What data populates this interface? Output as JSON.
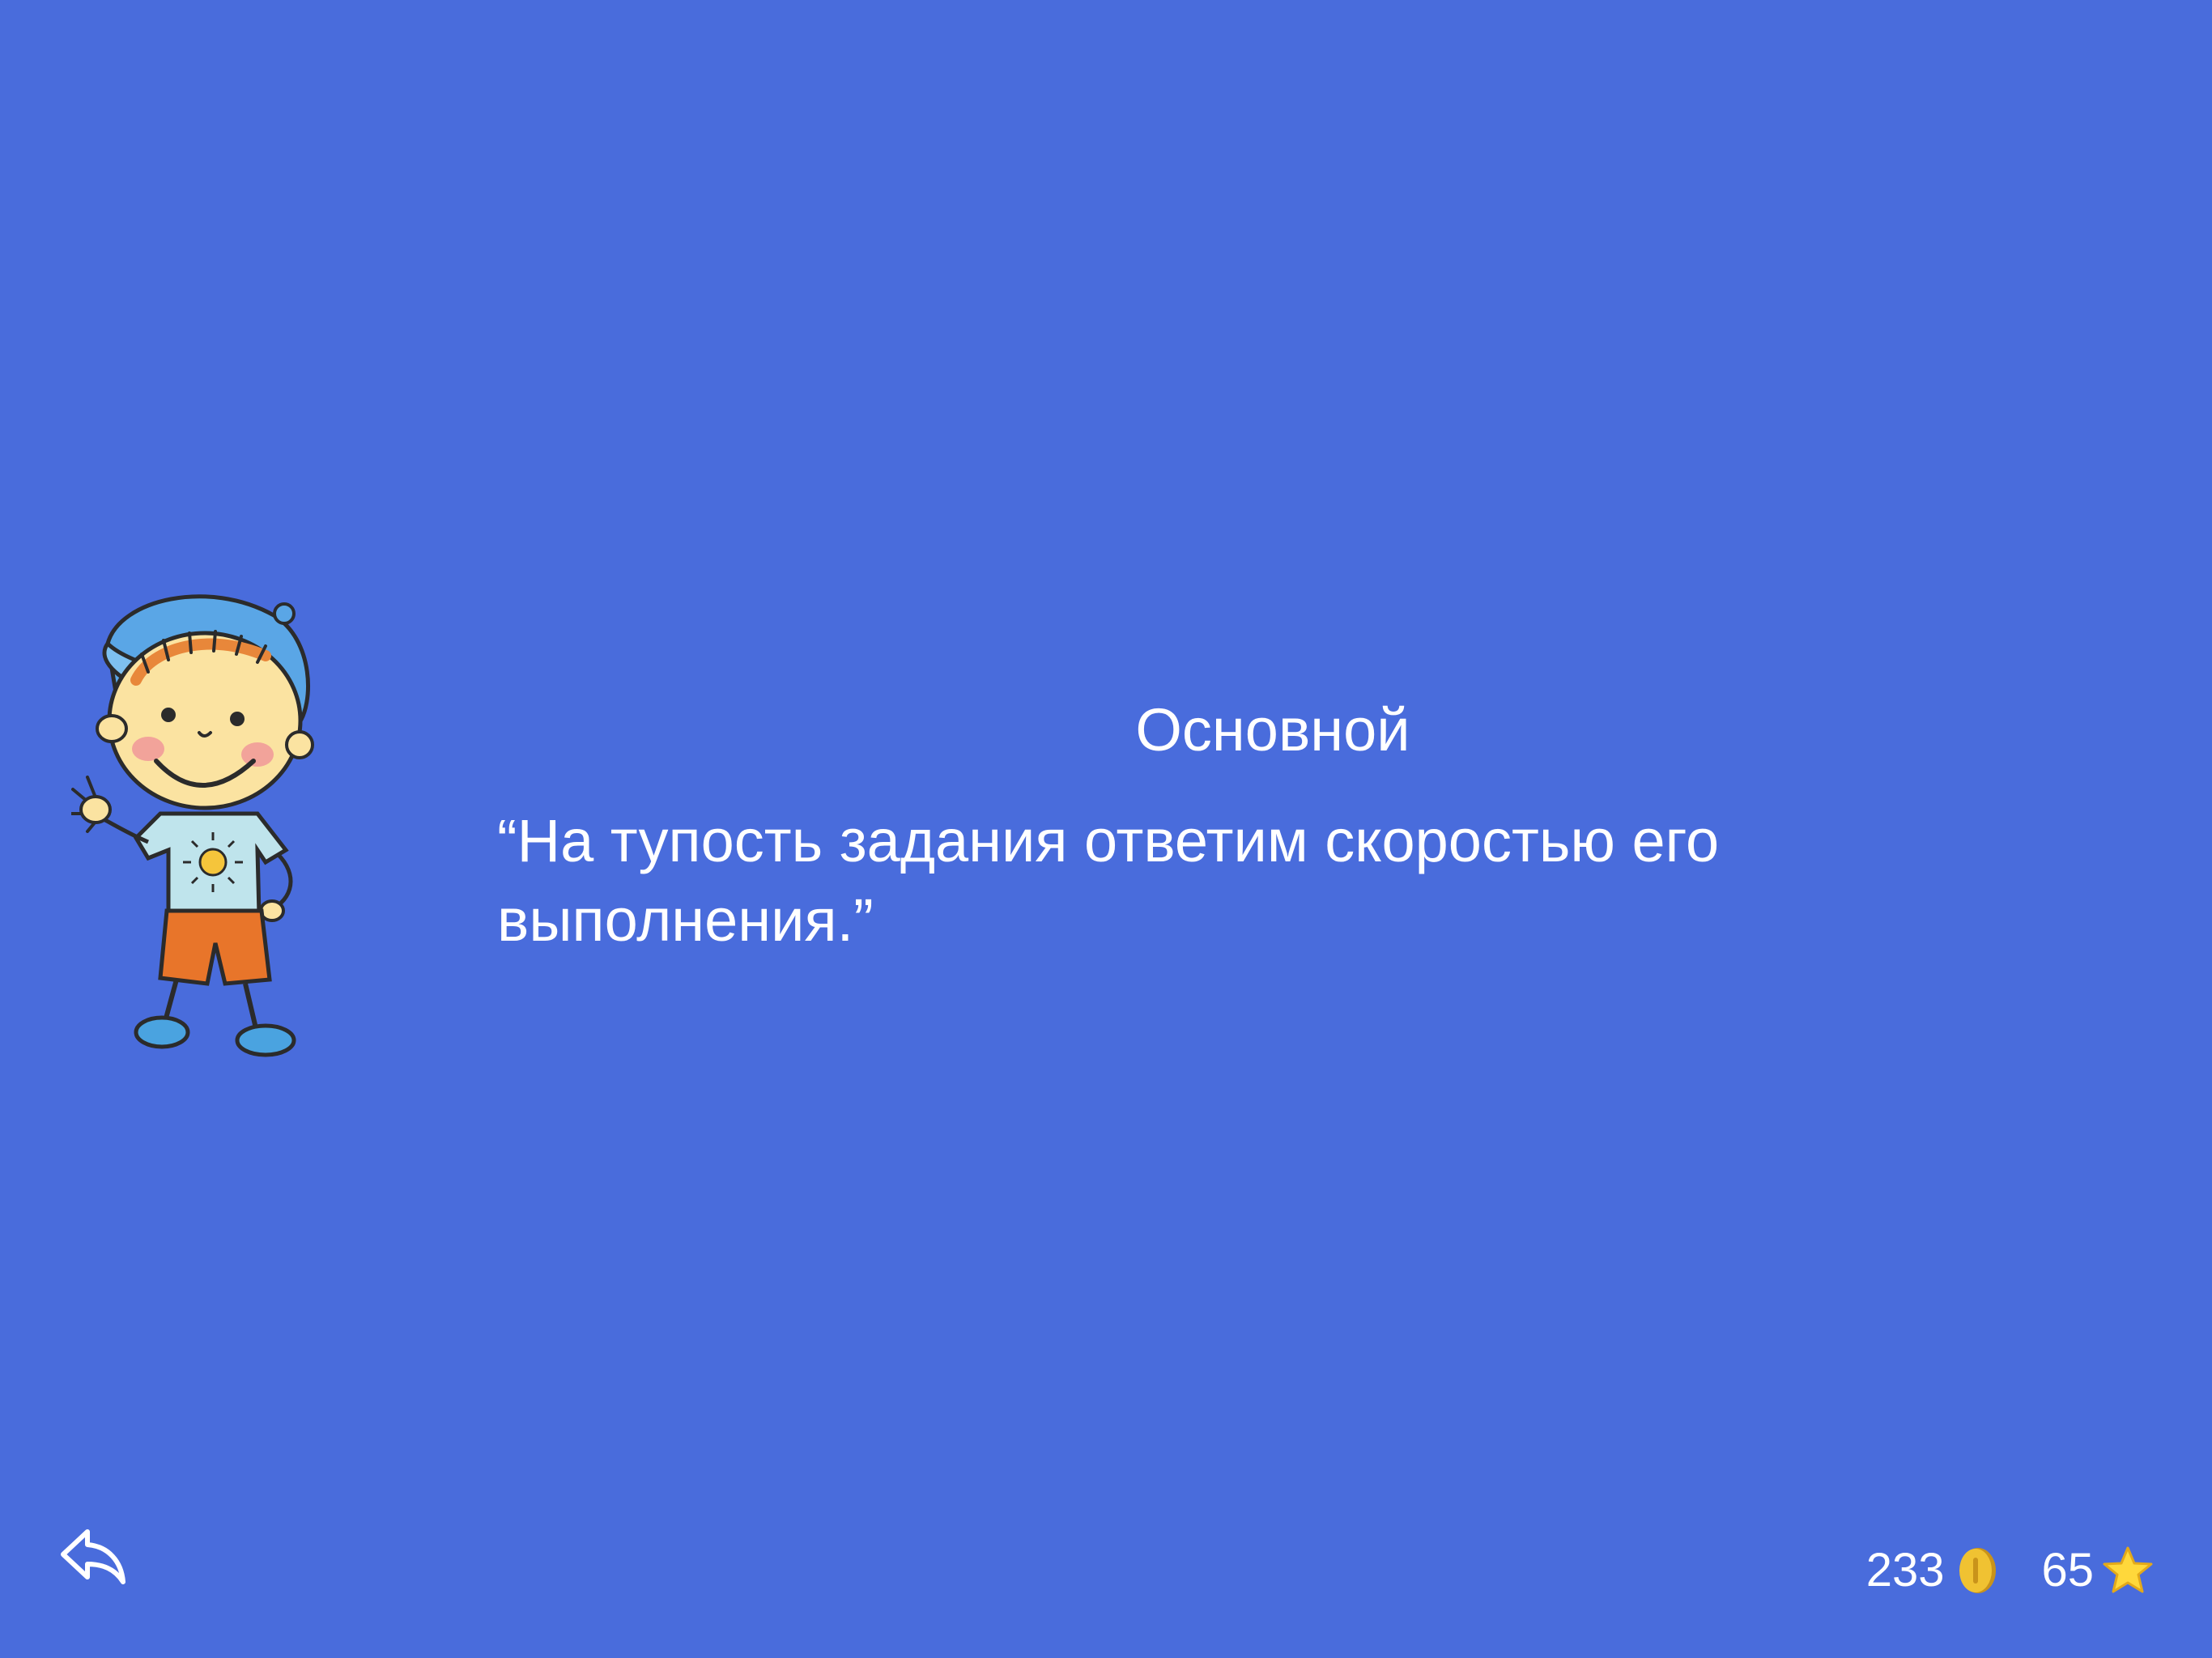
{
  "content": {
    "title": "Основной",
    "quote": "“На тупость задания ответим скоростью его выполнения.”"
  },
  "footer": {
    "coins": "233",
    "stars": "65",
    "back_icon": "back-arrow-icon",
    "coin_icon": "coin-icon",
    "star_icon": "star-icon"
  },
  "colors": {
    "background": "#496cdc",
    "text": "#ffffff",
    "coin": "#e9b824",
    "star": "#ffd83b"
  }
}
